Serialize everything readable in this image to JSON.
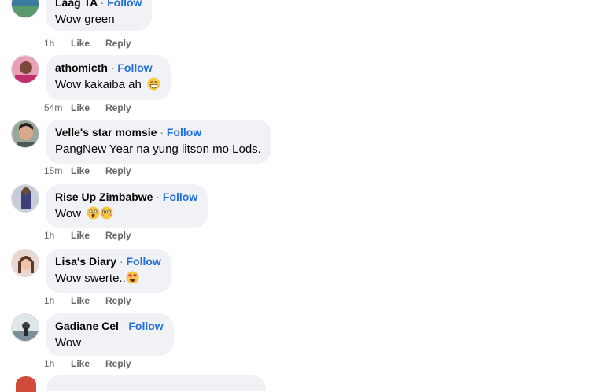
{
  "comments": [
    {
      "author": "Laag TA",
      "follow": "Follow",
      "text": "Wow green",
      "time": "1h",
      "like": "Like",
      "reply": "Reply"
    },
    {
      "author": "athomicth",
      "follow": "Follow",
      "text": "Wow kakaiba ah",
      "time": "54m",
      "like": "Like",
      "reply": "Reply",
      "emojis": [
        "grinning-sweat-emoji"
      ]
    },
    {
      "author": "Velle's star momsie",
      "follow": "Follow",
      "text": "PangNew Year na yung litson mo Lods.",
      "time": "15m",
      "like": "Like",
      "reply": "Reply"
    },
    {
      "author": "Rise Up Zimbabwe",
      "follow": "Follow",
      "text": "Wow",
      "time": "1h",
      "like": "Like",
      "reply": "Reply",
      "emojis": [
        "astonished-emoji",
        "flushed-emoji"
      ]
    },
    {
      "author": "Lisa's Diary",
      "follow": "Follow",
      "text": "Wow swerte..",
      "time": "1h",
      "like": "Like",
      "reply": "Reply",
      "emojis": [
        "heart-eyes-emoji"
      ]
    },
    {
      "author": "Gadiane Cel",
      "follow": "Follow",
      "text": "Wow",
      "time": "1h",
      "like": "Like",
      "reply": "Reply"
    }
  ],
  "separator": "·",
  "colors": {
    "bubble": "#f0f2f5",
    "follow_link": "#216fdb",
    "meta_text": "#65676b",
    "text": "#050505"
  }
}
